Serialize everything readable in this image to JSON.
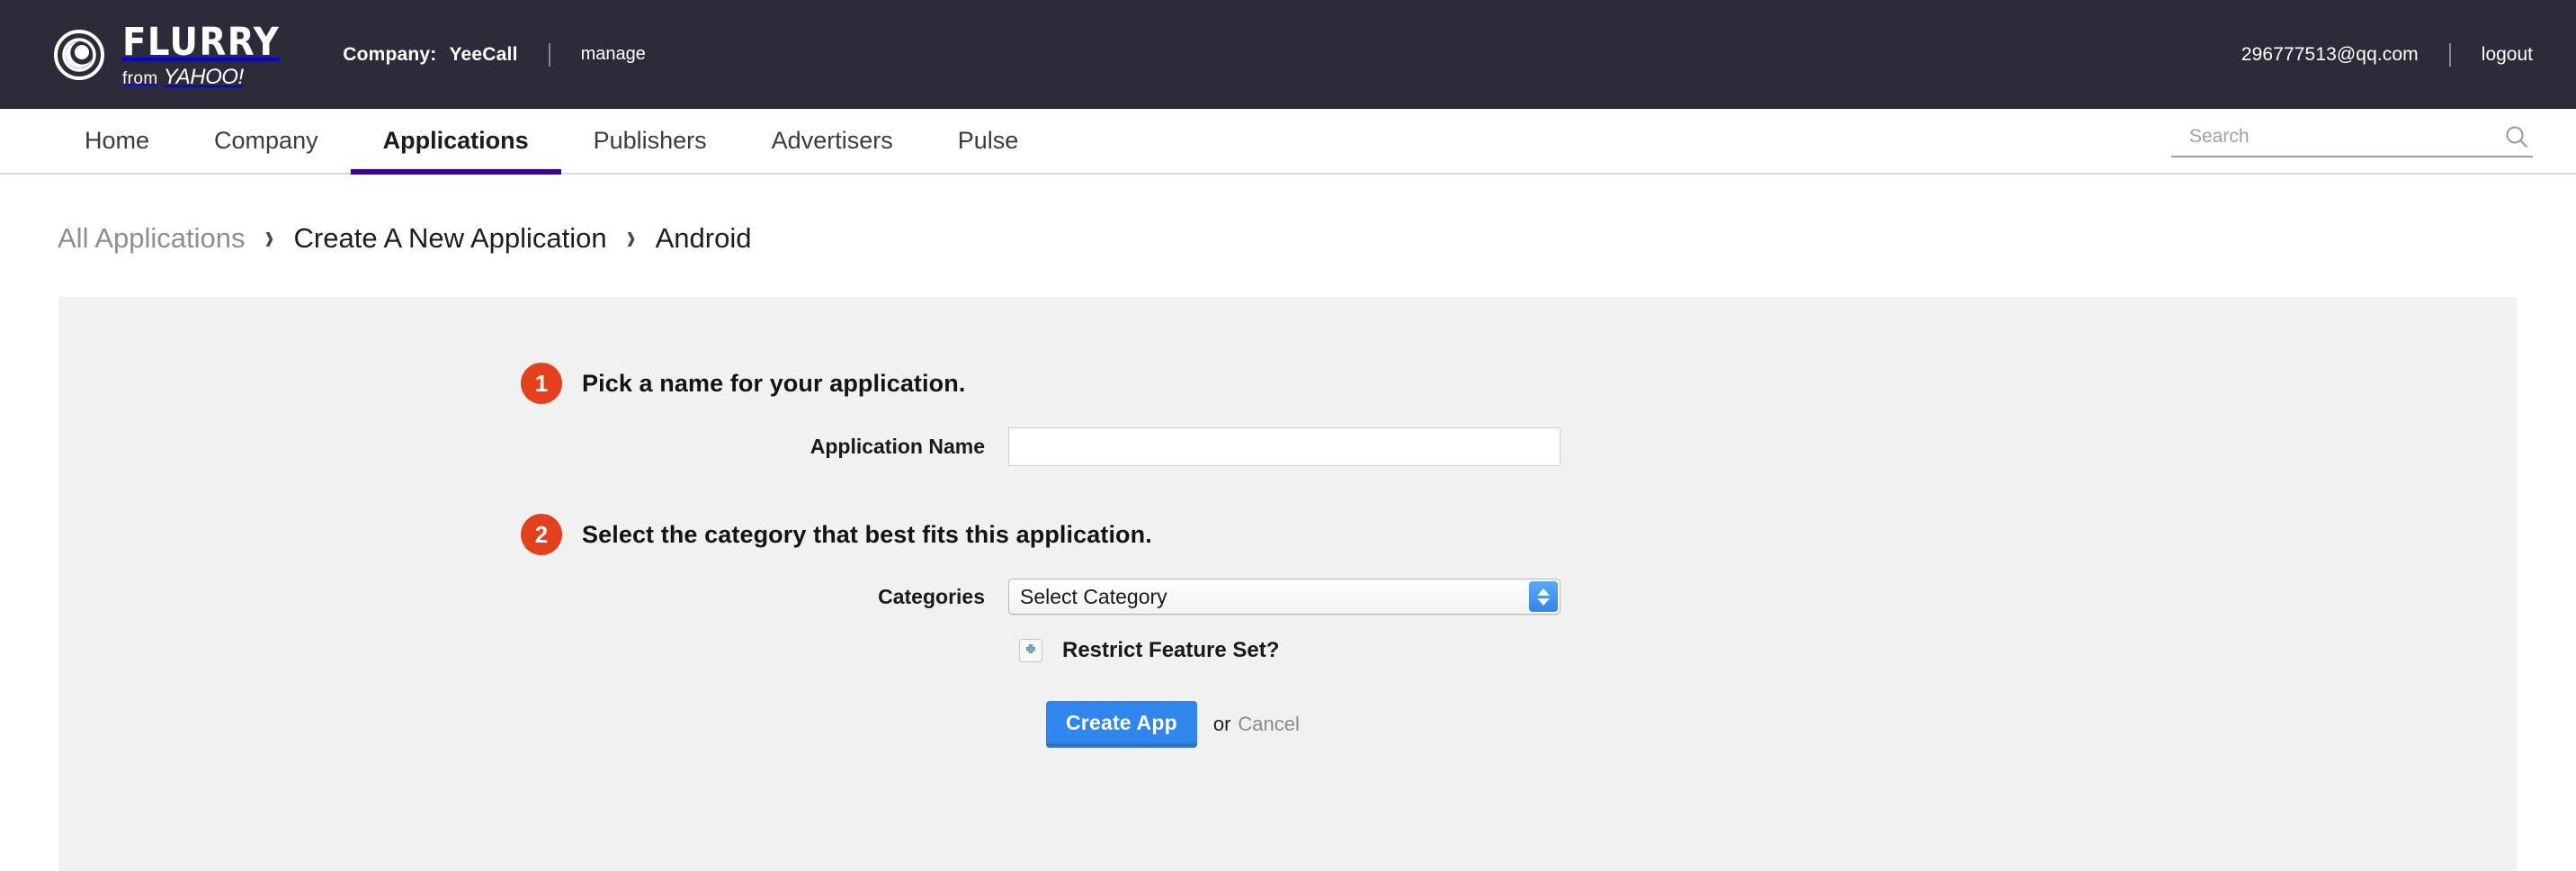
{
  "topbar": {
    "logo_mark": "flurry-circle-logo",
    "brand_primary": "FLURRY",
    "brand_from": "from",
    "brand_yahoo": "YAHOO!",
    "company_label": "Company:",
    "company_name": "YeeCall",
    "manage_link": "manage",
    "account_email": "296777513@qq.com",
    "logout_link": "logout",
    "background_color": "#2d2b3a"
  },
  "nav": {
    "items": [
      {
        "label": "Home",
        "active": false
      },
      {
        "label": "Company",
        "active": false
      },
      {
        "label": "Applications",
        "active": true
      },
      {
        "label": "Publishers",
        "active": false
      },
      {
        "label": "Advertisers",
        "active": false
      },
      {
        "label": "Pulse",
        "active": false
      }
    ],
    "active_underline_color": "#3d0099"
  },
  "search": {
    "placeholder": "Search",
    "value": "",
    "icon": "magnifier-icon"
  },
  "breadcrumb": {
    "separator": "›",
    "items": [
      {
        "label": "All Applications",
        "muted": true
      },
      {
        "label": "Create A New Application",
        "muted": false
      },
      {
        "label": "Android",
        "muted": false
      }
    ]
  },
  "form": {
    "panel_background": "#f1f1f1",
    "badge_color": "#e5401c",
    "steps": [
      {
        "number": "1",
        "title": "Pick a name for your application."
      },
      {
        "number": "2",
        "title": "Select the category that best fits this application."
      }
    ],
    "app_name": {
      "label": "Application Name",
      "value": "",
      "placeholder": ""
    },
    "categories": {
      "label": "Categories",
      "selected": "Select Category"
    },
    "restrict": {
      "label": "Restrict Feature Set?",
      "icon": "plus-toggle-icon",
      "checked": false
    },
    "actions": {
      "submit_label": "Create App",
      "or_text": "or",
      "cancel_label": "Cancel",
      "submit_color": "#2f86ef"
    }
  }
}
